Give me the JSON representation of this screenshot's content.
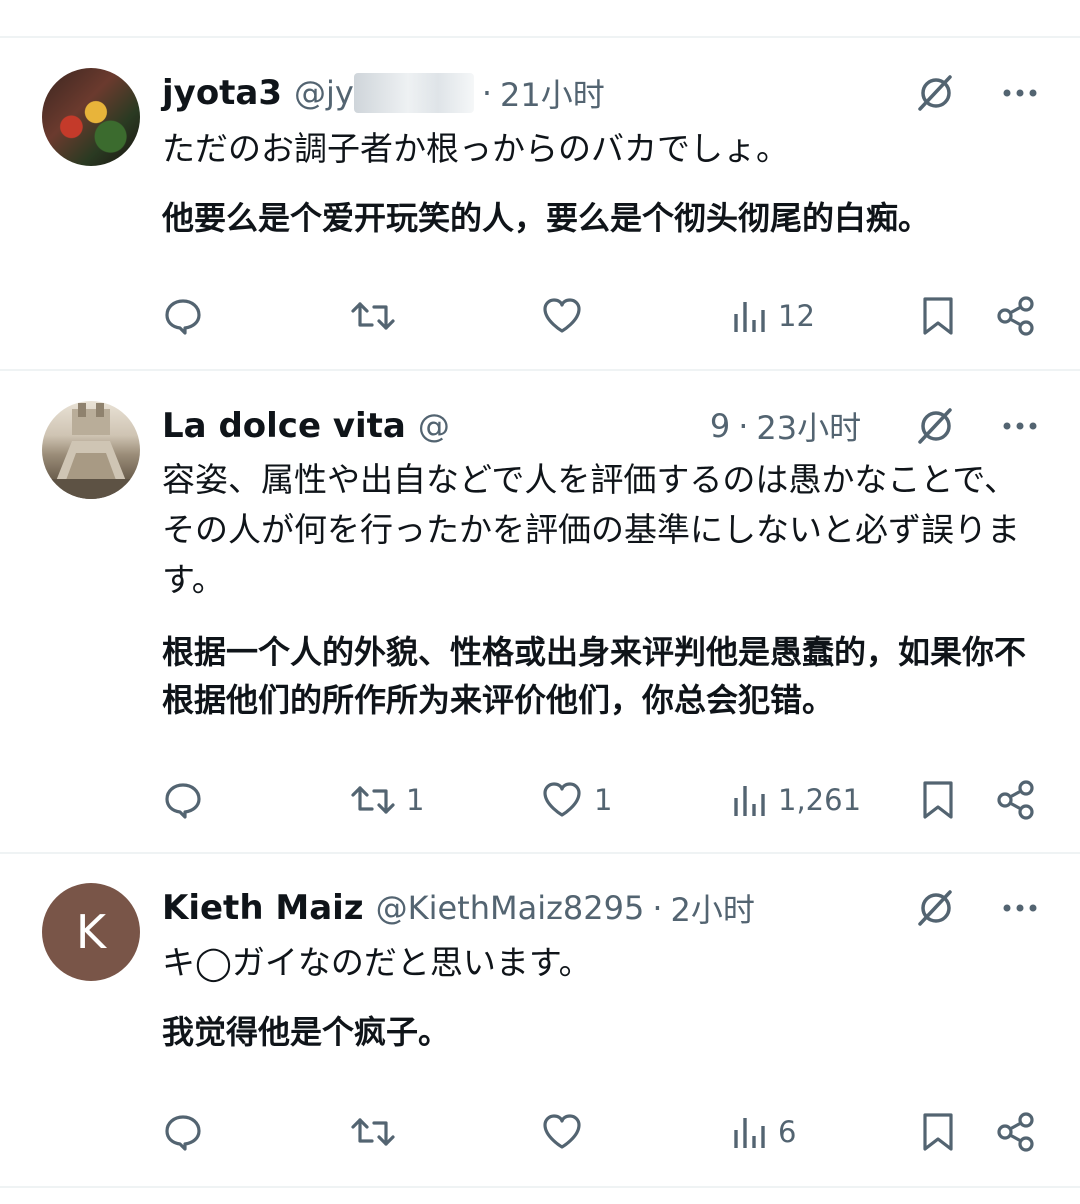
{
  "tweets": [
    {
      "name": "jyota3",
      "handle": "@jy",
      "time": "21小时",
      "text_ja": "ただのお調子者か根っからのバカでしょ。",
      "text_zh": "他要么是个爱开玩笑的人，要么是个彻头彻尾的白痴。",
      "reply_count": "",
      "retweet_count": "",
      "like_count": "",
      "views": "12"
    },
    {
      "name": "La dolce vita",
      "handle": "@",
      "handle_tail": "9",
      "time": "23小时",
      "text_ja": "容姿、属性や出自などで人を評価するのは愚かなことで、その人が何を行ったかを評価の基準にしないと必ず誤ります。",
      "text_zh": "根据一个人的外貌、性格或出身来评判他是愚蠢的，如果你不根据他们的所作所为来评价他们，你总会犯错。",
      "reply_count": "",
      "retweet_count": "1",
      "like_count": "1",
      "views": "1,261"
    },
    {
      "name": "Kieth Maiz",
      "avatar_letter": "K",
      "handle": "@KiethMaiz8295",
      "time": "2小时",
      "text_ja": "キ◯ガイなのだと思います。",
      "text_zh": "我觉得他是个疯子。",
      "reply_count": "",
      "retweet_count": "",
      "like_count": "",
      "views": "6"
    }
  ],
  "colors": {
    "text": "#0f1419",
    "secondary": "#536471",
    "divider": "#eff3f4",
    "avatar_k": "#795548"
  },
  "icons": [
    "reply-icon",
    "retweet-icon",
    "like-icon",
    "views-icon",
    "bookmark-icon",
    "share-icon",
    "grok-icon",
    "more-icon"
  ]
}
